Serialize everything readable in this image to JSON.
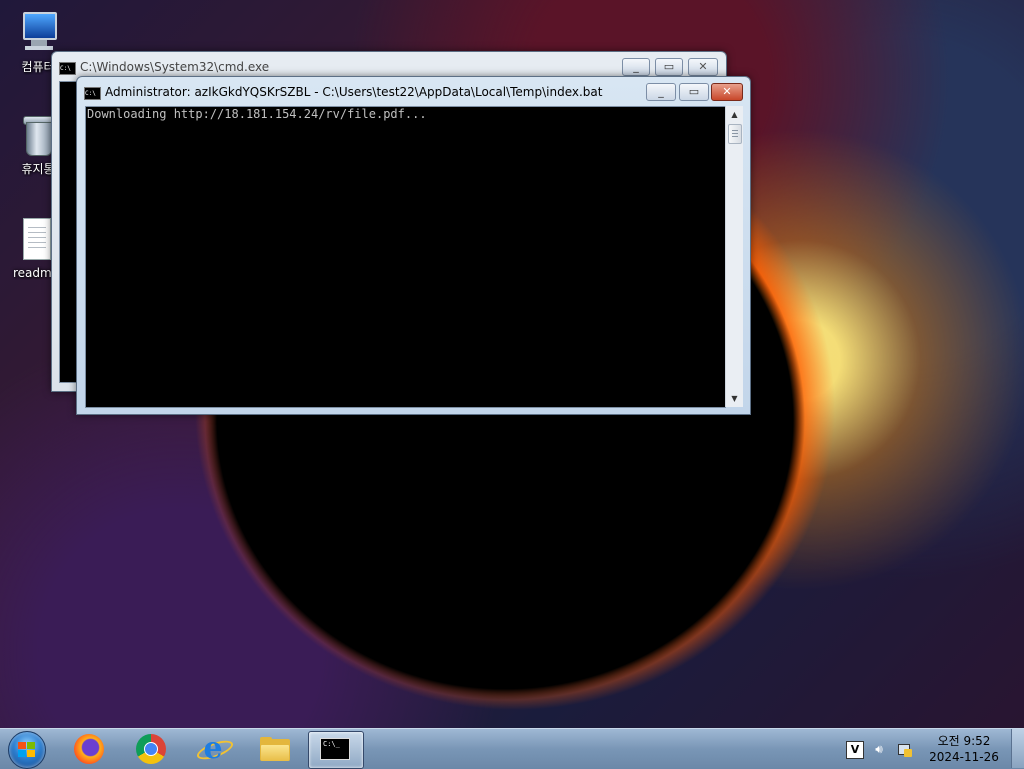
{
  "desktop": {
    "icons": [
      {
        "label": "컴퓨터",
        "icon": "computer-icon"
      },
      {
        "label": "휴지통",
        "icon": "recycle-bin-icon"
      },
      {
        "label": "readme",
        "icon": "text-document-icon"
      }
    ]
  },
  "windows": {
    "background_cmd": {
      "title": "C:\\Windows\\System32\\cmd.exe",
      "icon": "cmd-icon",
      "controls": {
        "minimize": "minimize-icon",
        "maximize": "maximize-icon",
        "close": "close-icon"
      }
    },
    "foreground_cmd": {
      "title": "Administrator:  azIkGkdYQSKrSZBL - C:\\Users\\test22\\AppData\\Local\\Temp\\index.bat",
      "icon": "cmd-icon",
      "console_lines": [
        "Downloading http://18.181.154.24/rv/file.pdf..."
      ],
      "controls": {
        "minimize": "minimize-icon",
        "maximize": "maximize-icon",
        "close": "close-icon"
      }
    }
  },
  "taskbar": {
    "start": "windows-start-icon",
    "pinned": [
      "firefox-icon",
      "chrome-icon",
      "internet-explorer-icon",
      "file-explorer-icon",
      "command-prompt-icon"
    ],
    "active_app": "command-prompt-icon",
    "cmd_icon_text": "C:\\_",
    "tray": {
      "icons": [
        "ime-icon",
        "volume-icon",
        "network-icon"
      ],
      "ime_label": "V"
    },
    "clock": {
      "time": "오전 9:52",
      "date": "2024-11-26"
    }
  },
  "colors": {
    "console_bg": "#000000",
    "console_fg": "#c0c0c0",
    "taskbar": "#7996b6",
    "close_button": "#c8472a"
  }
}
